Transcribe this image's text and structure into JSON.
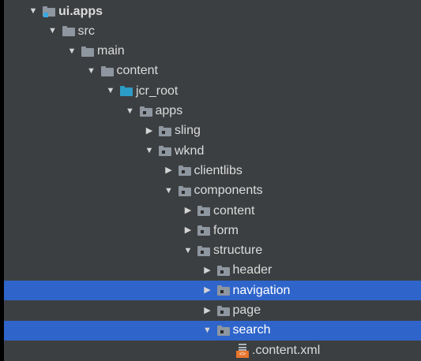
{
  "tree": {
    "items": [
      {
        "label": "ui.apps",
        "depth": 0,
        "icon": "module-folder-icon",
        "arrow": "expanded",
        "bold": true,
        "selected": false
      },
      {
        "label": "src",
        "depth": 1,
        "icon": "folder-icon",
        "arrow": "expanded",
        "bold": false,
        "selected": false
      },
      {
        "label": "main",
        "depth": 2,
        "icon": "folder-icon",
        "arrow": "expanded",
        "bold": false,
        "selected": false
      },
      {
        "label": "content",
        "depth": 3,
        "icon": "folder-icon",
        "arrow": "expanded",
        "bold": false,
        "selected": false
      },
      {
        "label": "jcr_root",
        "depth": 4,
        "icon": "source-folder-icon",
        "arrow": "expanded",
        "bold": false,
        "selected": false
      },
      {
        "label": "apps",
        "depth": 5,
        "icon": "package-folder-icon",
        "arrow": "expanded",
        "bold": false,
        "selected": false
      },
      {
        "label": "sling",
        "depth": 6,
        "icon": "package-folder-icon",
        "arrow": "collapsed",
        "bold": false,
        "selected": false
      },
      {
        "label": "wknd",
        "depth": 6,
        "icon": "package-folder-icon",
        "arrow": "expanded",
        "bold": false,
        "selected": false
      },
      {
        "label": "clientlibs",
        "depth": 7,
        "icon": "package-folder-icon",
        "arrow": "collapsed",
        "bold": false,
        "selected": false
      },
      {
        "label": "components",
        "depth": 7,
        "icon": "package-folder-icon",
        "arrow": "expanded",
        "bold": false,
        "selected": false
      },
      {
        "label": "content",
        "depth": 8,
        "icon": "package-folder-icon",
        "arrow": "collapsed",
        "bold": false,
        "selected": false
      },
      {
        "label": "form",
        "depth": 8,
        "icon": "package-folder-icon",
        "arrow": "collapsed",
        "bold": false,
        "selected": false
      },
      {
        "label": "structure",
        "depth": 8,
        "icon": "package-folder-icon",
        "arrow": "expanded",
        "bold": false,
        "selected": false
      },
      {
        "label": "header",
        "depth": 9,
        "icon": "package-folder-icon",
        "arrow": "collapsed",
        "bold": false,
        "selected": false
      },
      {
        "label": "navigation",
        "depth": 9,
        "icon": "package-folder-icon",
        "arrow": "collapsed",
        "bold": false,
        "selected": true
      },
      {
        "label": "page",
        "depth": 9,
        "icon": "package-folder-icon",
        "arrow": "collapsed",
        "bold": false,
        "selected": false
      },
      {
        "label": "search",
        "depth": 9,
        "icon": "package-folder-icon",
        "arrow": "expanded",
        "bold": false,
        "selected": true
      },
      {
        "label": ".content.xml",
        "depth": 10,
        "icon": "xml-file-icon",
        "arrow": "none",
        "bold": false,
        "selected": false
      }
    ]
  },
  "colors": {
    "background": "#3c3f41",
    "selection": "#2f65ca",
    "text": "#dcdcdc",
    "folder": "#8e96a0",
    "source_folder": "#2b9cc5",
    "xml_badge": "#e8752c"
  },
  "glyphs": {
    "expanded": "▼",
    "collapsed": "▶",
    "xml_badge": "<>"
  }
}
